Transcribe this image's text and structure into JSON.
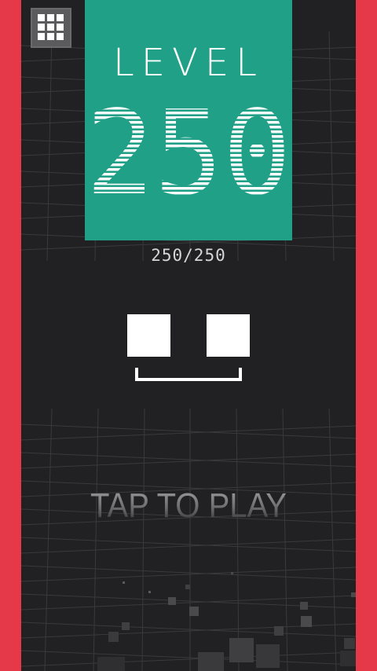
{
  "level": {
    "label": "LEVEL",
    "number": "250",
    "progress": "250/250"
  },
  "menu": {
    "icon": "grid-menu-icon"
  },
  "prompt": {
    "text": "TAP TO PLAY"
  },
  "colors": {
    "background": "#212123",
    "side_bars": "#e53848",
    "level_panel": "#21a088",
    "menu_button": "#5b5b5d",
    "character": "#ffffff",
    "grid_lines": "#3a3a3d"
  }
}
